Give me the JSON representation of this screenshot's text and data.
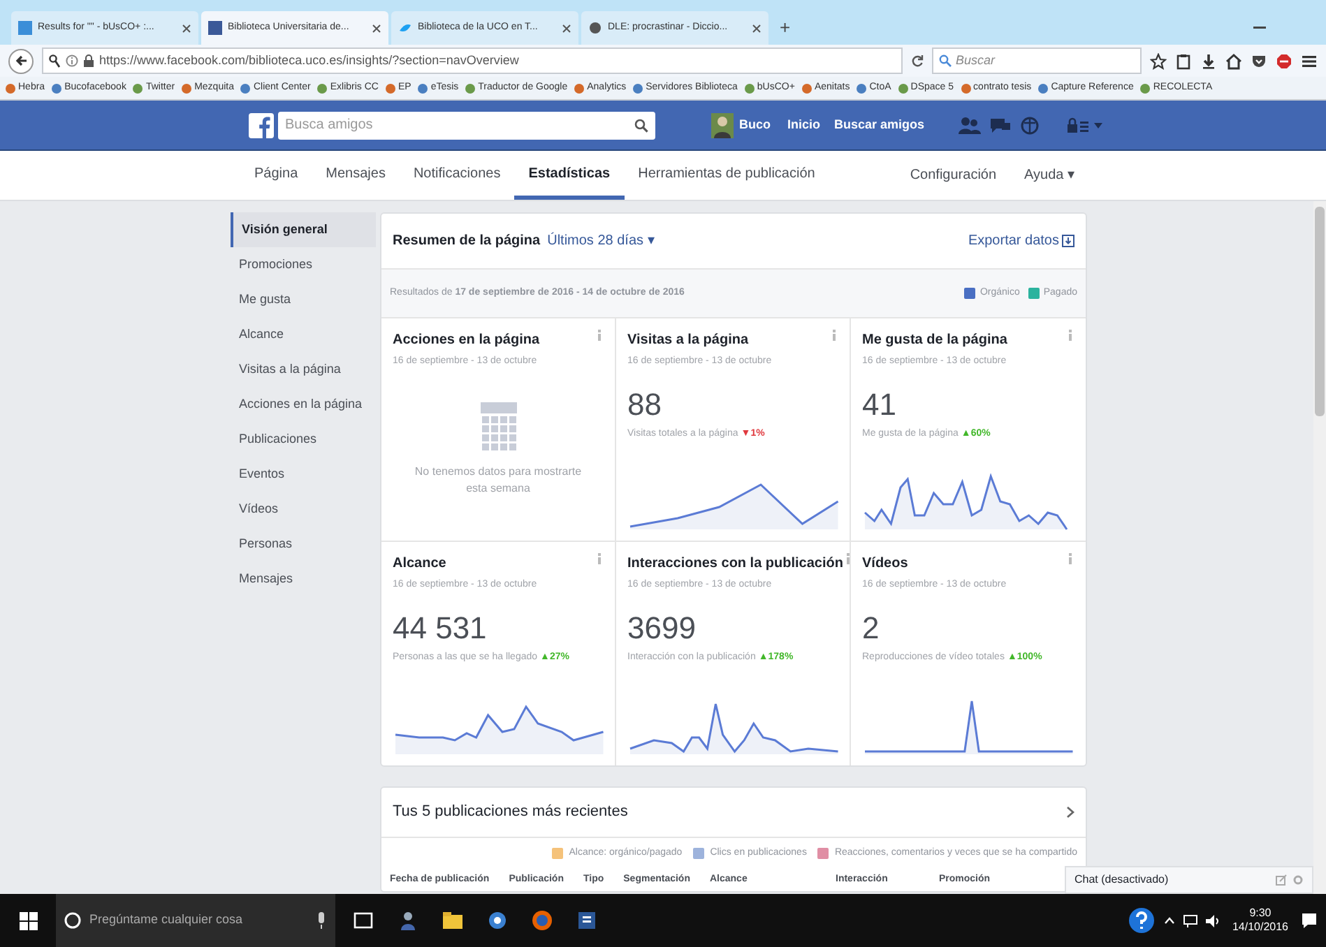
{
  "browser": {
    "tabs": [
      {
        "title": "Results for \"\" - bUsCO+ :...",
        "selected": false
      },
      {
        "title": "Biblioteca Universitaria de...",
        "selected": true
      },
      {
        "title": "Biblioteca de la UCO en T...",
        "selected": false
      },
      {
        "title": "DLE: procrastinar - Diccio...",
        "selected": false
      }
    ],
    "new_tab": "+",
    "url": "https://www.facebook.com/biblioteca.uco.es/insights/?section=navOverview",
    "search": {
      "placeholder": "Buscar"
    },
    "bookmarks": [
      "Hebra",
      "Bucofacebook",
      "Twitter",
      "Mezquita",
      "Client Center",
      "Exlibris CC",
      "EP",
      "eTesis",
      "Traductor de Google",
      "Analytics",
      "Servidores Biblioteca",
      "bUsCO+",
      "Aenitats",
      "CtoA",
      "DSpace 5",
      "contrato tesis",
      "Capture Reference",
      "RECOLECTA"
    ]
  },
  "facebook": {
    "search": {
      "placeholder": "Busca amigos"
    },
    "user": "Buco",
    "links": [
      "Inicio",
      "Buscar amigos"
    ]
  },
  "page_tabs": [
    {
      "label": "Página",
      "selected": false
    },
    {
      "label": "Mensajes",
      "selected": false
    },
    {
      "label": "Notificaciones",
      "selected": false
    },
    {
      "label": "Estadísticas",
      "selected": true
    },
    {
      "label": "Herramientas de publicación",
      "selected": false
    }
  ],
  "page_tabs_right": [
    "Configuración",
    "Ayuda ▾"
  ],
  "sidebar": [
    {
      "label": "Visión general",
      "selected": true
    },
    {
      "label": "Promociones",
      "selected": false
    },
    {
      "label": "Me gusta",
      "selected": false
    },
    {
      "label": "Alcance",
      "selected": false
    },
    {
      "label": "Visitas a la página",
      "selected": false
    },
    {
      "label": "Acciones en la página",
      "selected": false
    },
    {
      "label": "Publicaciones",
      "selected": false
    },
    {
      "label": "Eventos",
      "selected": false
    },
    {
      "label": "Vídeos",
      "selected": false
    },
    {
      "label": "Personas",
      "selected": false
    },
    {
      "label": "Mensajes",
      "selected": false
    }
  ],
  "summary": {
    "title": "Resumen de la página",
    "period": "Últimos 28 días ▾",
    "export": "Exportar datos",
    "results": "Resultados de **17 de septiembre de 2016 - 14 de octubre de 2016**",
    "legend": [
      {
        "label": "Orgánico",
        "color": "#4a6fc3"
      },
      {
        "label": "Pagado",
        "color": "#2bb39e"
      }
    ],
    "cards": [
      {
        "kind": "empty",
        "title": "Acciones en la página",
        "dates": "16 de septiembre - 13 de octubre",
        "message": "No tenemos datos para mostrarte esta semana"
      },
      {
        "kind": "metric",
        "title": "Visitas a la página",
        "dates": "16 de septiembre - 13 de octubre",
        "value": "88",
        "caption": "Visitas totales a la página",
        "color": "#e0393e",
        "change": "▼1%"
      },
      {
        "kind": "metric",
        "title": "Me gusta de la página",
        "dates": "16 de septiembre - 13 de octubre",
        "value": "41",
        "caption": "Me gusta de la página",
        "color": "#42b72a",
        "change": "▲60%"
      },
      {
        "kind": "metric",
        "title": "Alcance",
        "dates": "16 de septiembre - 13 de octubre",
        "value": "44 531",
        "caption": "Personas a las que se ha llegado",
        "color": "#42b72a",
        "change": "▲27%"
      },
      {
        "kind": "metric",
        "title": "Interacciones con la publicación",
        "dates": "16 de septiembre - 13 de octubre",
        "value": "3699",
        "caption": "Interacción con la publicación",
        "color": "#42b72a",
        "change": "▲178%"
      },
      {
        "kind": "metric",
        "title": "Vídeos",
        "dates": "16 de septiembre - 13 de octubre",
        "value": "2",
        "caption": "Reproducciones de vídeo totales",
        "color": "#42b72a",
        "change": "▲100%"
      }
    ]
  },
  "recent": {
    "title": "Tus 5 publicaciones más recientes",
    "legend": [
      {
        "label": "Alcance: orgánico/pagado",
        "color": "#f5c27a"
      },
      {
        "label": "Clics en publicaciones",
        "color": "#9db3dc"
      },
      {
        "label": "Reacciones, comentarios y veces que se ha compartido",
        "color": "#e08ea4"
      }
    ],
    "columns": [
      "Fecha de publicación",
      "Publicación",
      "Tipo",
      "Segmentación",
      "Alcance",
      "Interacción",
      "Promoción"
    ]
  },
  "chat": "Chat (desactivado)",
  "taskbar": {
    "search": {
      "placeholder": "Pregúntame cualquier cosa"
    },
    "time": "9:30",
    "date": "14/10/2016"
  }
}
